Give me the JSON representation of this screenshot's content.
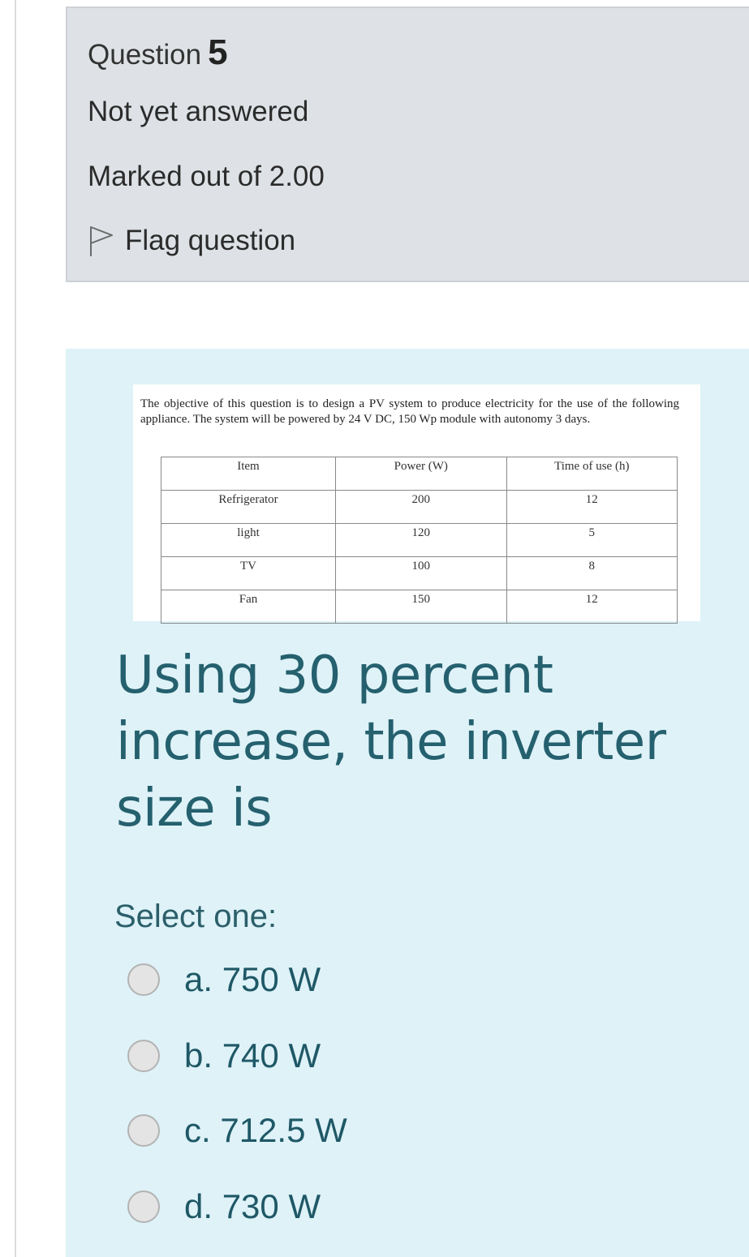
{
  "info": {
    "question_word": "Question",
    "question_number": "5",
    "state": "Not yet answered",
    "grade": "Marked out of 2.00",
    "flag_label": "Flag question",
    "flag_icon": "flag-outline-icon"
  },
  "content": {
    "intro": "The objective of this question is to design a PV system to produce electricity for the use of the following appliance. The system will be powered by 24 V DC, 150 Wp module with autonomy 3 days.",
    "table": {
      "headers": [
        "Item",
        "Power (W)",
        "Time of use (h)"
      ],
      "rows": [
        [
          "Refrigerator",
          "200",
          "12"
        ],
        [
          "light",
          "120",
          "5"
        ],
        [
          "TV",
          "100",
          "8"
        ],
        [
          "Fan",
          "150",
          "12"
        ]
      ]
    },
    "question": "Using 30 percent increase, the inverter size is",
    "select_label": "Select one:",
    "options": [
      {
        "label": "a. 750 W"
      },
      {
        "label": "b. 740 W"
      },
      {
        "label": "c. 712.5 W"
      },
      {
        "label": "d. 730 W"
      }
    ]
  },
  "colors": {
    "info_bg": "#dee2e6",
    "content_bg": "#def2f8",
    "question_text": "#25606e"
  }
}
